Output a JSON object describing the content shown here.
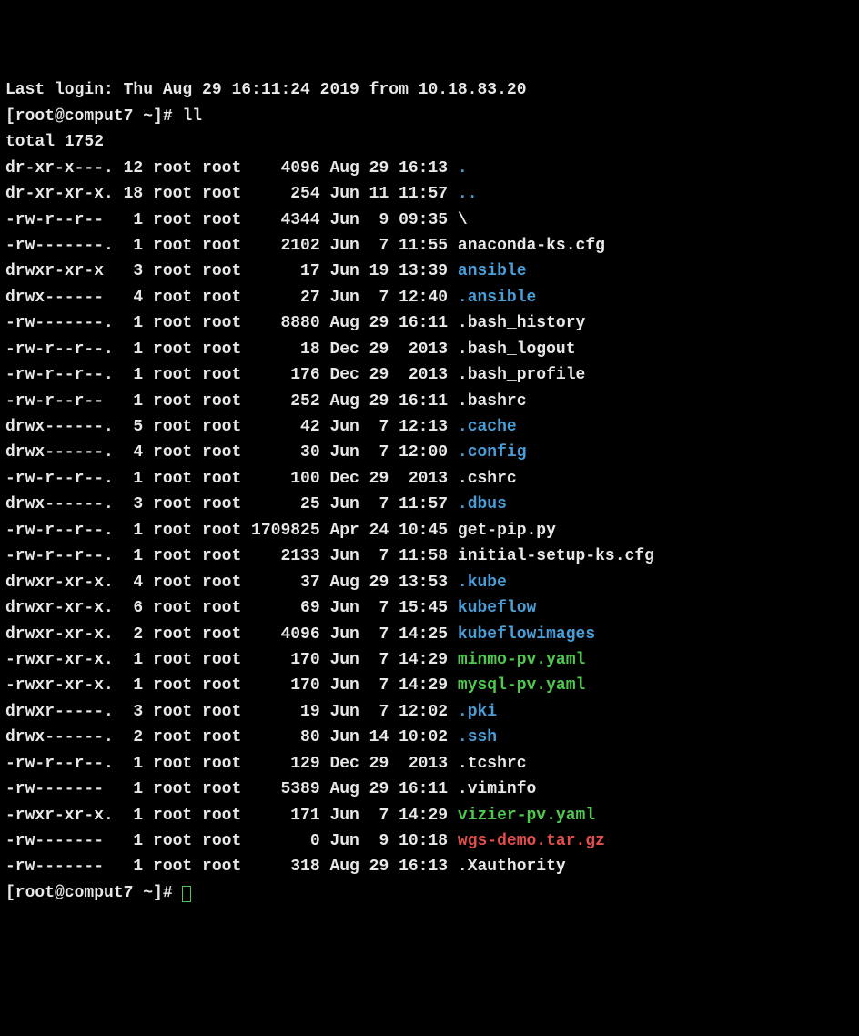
{
  "last_login_line": "Last login: Thu Aug 29 16:11:24 2019 from 10.18.83.20",
  "prompt": "[root@comput7 ~]# ",
  "command": "ll",
  "total_line": "total 1752",
  "entries": [
    {
      "perms": "dr-xr-x---.",
      "links": "12",
      "owner": "root",
      "group": "root",
      "size": "4096",
      "month": "Aug",
      "day": "29",
      "time": "16:13",
      "name": ".",
      "kind": "dir"
    },
    {
      "perms": "dr-xr-xr-x.",
      "links": "18",
      "owner": "root",
      "group": "root",
      "size": "254",
      "month": "Jun",
      "day": "11",
      "time": "11:57",
      "name": "..",
      "kind": "dir"
    },
    {
      "perms": "-rw-r--r--",
      "links": "1",
      "owner": "root",
      "group": "root",
      "size": "4344",
      "month": "Jun",
      "day": " 9",
      "time": "09:35",
      "name": "\\",
      "kind": "file"
    },
    {
      "perms": "-rw-------.",
      "links": "1",
      "owner": "root",
      "group": "root",
      "size": "2102",
      "month": "Jun",
      "day": " 7",
      "time": "11:55",
      "name": "anaconda-ks.cfg",
      "kind": "file"
    },
    {
      "perms": "drwxr-xr-x",
      "links": "3",
      "owner": "root",
      "group": "root",
      "size": "17",
      "month": "Jun",
      "day": "19",
      "time": "13:39",
      "name": "ansible",
      "kind": "dir"
    },
    {
      "perms": "drwx------",
      "links": "4",
      "owner": "root",
      "group": "root",
      "size": "27",
      "month": "Jun",
      "day": " 7",
      "time": "12:40",
      "name": ".ansible",
      "kind": "dir"
    },
    {
      "perms": "-rw-------.",
      "links": "1",
      "owner": "root",
      "group": "root",
      "size": "8880",
      "month": "Aug",
      "day": "29",
      "time": "16:11",
      "name": ".bash_history",
      "kind": "file"
    },
    {
      "perms": "-rw-r--r--.",
      "links": "1",
      "owner": "root",
      "group": "root",
      "size": "18",
      "month": "Dec",
      "day": "29",
      "time": " 2013",
      "name": ".bash_logout",
      "kind": "file"
    },
    {
      "perms": "-rw-r--r--.",
      "links": "1",
      "owner": "root",
      "group": "root",
      "size": "176",
      "month": "Dec",
      "day": "29",
      "time": " 2013",
      "name": ".bash_profile",
      "kind": "file"
    },
    {
      "perms": "-rw-r--r--",
      "links": "1",
      "owner": "root",
      "group": "root",
      "size": "252",
      "month": "Aug",
      "day": "29",
      "time": "16:11",
      "name": ".bashrc",
      "kind": "file"
    },
    {
      "perms": "drwx------.",
      "links": "5",
      "owner": "root",
      "group": "root",
      "size": "42",
      "month": "Jun",
      "day": " 7",
      "time": "12:13",
      "name": ".cache",
      "kind": "dir"
    },
    {
      "perms": "drwx------.",
      "links": "4",
      "owner": "root",
      "group": "root",
      "size": "30",
      "month": "Jun",
      "day": " 7",
      "time": "12:00",
      "name": ".config",
      "kind": "dir"
    },
    {
      "perms": "-rw-r--r--.",
      "links": "1",
      "owner": "root",
      "group": "root",
      "size": "100",
      "month": "Dec",
      "day": "29",
      "time": " 2013",
      "name": ".cshrc",
      "kind": "file"
    },
    {
      "perms": "drwx------.",
      "links": "3",
      "owner": "root",
      "group": "root",
      "size": "25",
      "month": "Jun",
      "day": " 7",
      "time": "11:57",
      "name": ".dbus",
      "kind": "dir"
    },
    {
      "perms": "-rw-r--r--.",
      "links": "1",
      "owner": "root",
      "group": "root",
      "size": "1709825",
      "month": "Apr",
      "day": "24",
      "time": "10:45",
      "name": "get-pip.py",
      "kind": "file"
    },
    {
      "perms": "-rw-r--r--.",
      "links": "1",
      "owner": "root",
      "group": "root",
      "size": "2133",
      "month": "Jun",
      "day": " 7",
      "time": "11:58",
      "name": "initial-setup-ks.cfg",
      "kind": "file"
    },
    {
      "perms": "drwxr-xr-x.",
      "links": "4",
      "owner": "root",
      "group": "root",
      "size": "37",
      "month": "Aug",
      "day": "29",
      "time": "13:53",
      "name": ".kube",
      "kind": "dir"
    },
    {
      "perms": "drwxr-xr-x.",
      "links": "6",
      "owner": "root",
      "group": "root",
      "size": "69",
      "month": "Jun",
      "day": " 7",
      "time": "15:45",
      "name": "kubeflow",
      "kind": "dir"
    },
    {
      "perms": "drwxr-xr-x.",
      "links": "2",
      "owner": "root",
      "group": "root",
      "size": "4096",
      "month": "Jun",
      "day": " 7",
      "time": "14:25",
      "name": "kubeflowimages",
      "kind": "dir"
    },
    {
      "perms": "-rwxr-xr-x.",
      "links": "1",
      "owner": "root",
      "group": "root",
      "size": "170",
      "month": "Jun",
      "day": " 7",
      "time": "14:29",
      "name": "minmo-pv.yaml",
      "kind": "exec"
    },
    {
      "perms": "-rwxr-xr-x.",
      "links": "1",
      "owner": "root",
      "group": "root",
      "size": "170",
      "month": "Jun",
      "day": " 7",
      "time": "14:29",
      "name": "mysql-pv.yaml",
      "kind": "exec"
    },
    {
      "perms": "drwxr-----.",
      "links": "3",
      "owner": "root",
      "group": "root",
      "size": "19",
      "month": "Jun",
      "day": " 7",
      "time": "12:02",
      "name": ".pki",
      "kind": "dir"
    },
    {
      "perms": "drwx------.",
      "links": "2",
      "owner": "root",
      "group": "root",
      "size": "80",
      "month": "Jun",
      "day": "14",
      "time": "10:02",
      "name": ".ssh",
      "kind": "dir"
    },
    {
      "perms": "-rw-r--r--.",
      "links": "1",
      "owner": "root",
      "group": "root",
      "size": "129",
      "month": "Dec",
      "day": "29",
      "time": " 2013",
      "name": ".tcshrc",
      "kind": "file"
    },
    {
      "perms": "-rw-------",
      "links": "1",
      "owner": "root",
      "group": "root",
      "size": "5389",
      "month": "Aug",
      "day": "29",
      "time": "16:11",
      "name": ".viminfo",
      "kind": "file"
    },
    {
      "perms": "-rwxr-xr-x.",
      "links": "1",
      "owner": "root",
      "group": "root",
      "size": "171",
      "month": "Jun",
      "day": " 7",
      "time": "14:29",
      "name": "vizier-pv.yaml",
      "kind": "exec"
    },
    {
      "perms": "-rw-------",
      "links": "1",
      "owner": "root",
      "group": "root",
      "size": "0",
      "month": "Jun",
      "day": " 9",
      "time": "10:18",
      "name": "wgs-demo.tar.gz",
      "kind": "arch"
    },
    {
      "perms": "-rw-------",
      "links": "1",
      "owner": "root",
      "group": "root",
      "size": "318",
      "month": "Aug",
      "day": "29",
      "time": "16:13",
      "name": ".Xauthority",
      "kind": "file"
    }
  ],
  "prompt2": "[root@comput7 ~]# "
}
